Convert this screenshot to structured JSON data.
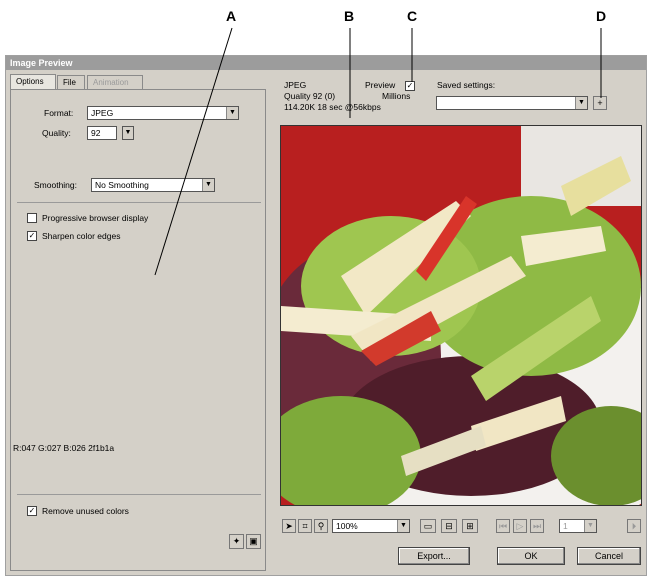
{
  "callouts": {
    "a": "A",
    "b": "B",
    "c": "C",
    "d": "D"
  },
  "window": {
    "title": "Image Preview"
  },
  "tabs": [
    {
      "label": "Options"
    },
    {
      "label": "File"
    },
    {
      "label": "Animation"
    }
  ],
  "options": {
    "format_label": "Format:",
    "format_value": "JPEG",
    "quality_label": "Quality:",
    "quality_value": "92",
    "smoothing_label": "Smoothing:",
    "smoothing_value": "No Smoothing",
    "progressive_label": "Progressive browser display",
    "progressive_checked": false,
    "sharpen_label": "Sharpen color edges",
    "sharpen_checked": true,
    "color_readout": "R:047 G:027 B:026 2f1b1a",
    "remove_unused_label": "Remove unused colors",
    "remove_unused_checked": true
  },
  "preview_info": {
    "format": "JPEG",
    "quality": "Quality 92 (0)",
    "size": "114.20K  18 sec @56kbps",
    "preview_label": "Preview",
    "preview_checked": true,
    "colors": "Millions",
    "saved_settings_label": "Saved settings:",
    "saved_settings_value": ""
  },
  "toolbar": {
    "zoom_value": "100%",
    "frame_value": "1"
  },
  "buttons": {
    "export": "Export...",
    "ok": "OK",
    "cancel": "Cancel"
  },
  "colors": {
    "titlebar": "#9c9c9c",
    "panel": "#d4d0c8"
  }
}
